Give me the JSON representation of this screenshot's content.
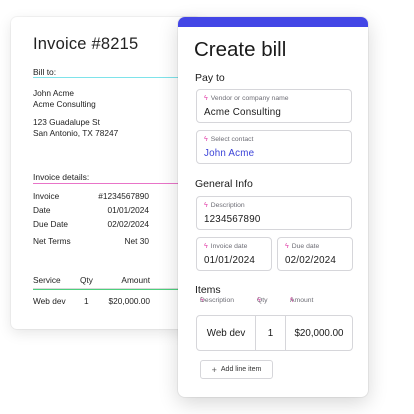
{
  "invoice": {
    "title": "Invoice #8215",
    "bill_to_label": "Bill to:",
    "name": "John Acme",
    "company": "Acme Consulting",
    "address_line1": "123 Guadalupe St",
    "address_line2": "San Antonio, TX 78247",
    "details_label": "Invoice details:",
    "details": [
      {
        "label": "Invoice",
        "value": "#1234567890"
      },
      {
        "label": "Date",
        "value": "01/01/2024"
      },
      {
        "label": "Due Date",
        "value": "02/02/2024"
      },
      {
        "label": "Net Terms",
        "value": "Net 30"
      }
    ],
    "table_headers": [
      "Service",
      "Qty",
      "Amount"
    ],
    "table_row": [
      "Web dev",
      "1",
      "$20,000.00"
    ]
  },
  "connectors": {
    "pay_to_color": "#7ee3ea",
    "general_info_color": "#e874c8",
    "items_color": "#4cd07d"
  },
  "bill": {
    "title": "Create bill",
    "accent_color": "#4346e6",
    "pay_to": {
      "label": "Pay to",
      "vendor_label": "Vendor or company name",
      "vendor_value": "Acme Consulting",
      "contact_label": "Select contact",
      "contact_value": "John Acme"
    },
    "general_info": {
      "label": "General Info",
      "description_label": "Description",
      "description_value": "1234567890",
      "invoice_date_label": "Invoice date",
      "invoice_date_value": "01/01/2024",
      "due_date_label": "Due date",
      "due_date_value": "02/02/2024"
    },
    "items": {
      "label": "Items",
      "col_description": "Description",
      "col_qty": "Qty",
      "col_amount": "Amount",
      "row_description": "Web dev",
      "row_qty": "1",
      "row_amount": "$20,000.00",
      "add_button": "Add line item"
    },
    "icons": {
      "autofill": "lightning-bolt-icon",
      "add": "plus-icon"
    }
  }
}
